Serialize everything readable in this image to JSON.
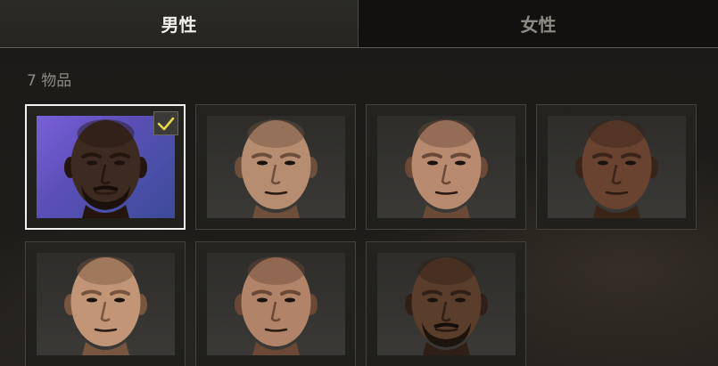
{
  "tabs": [
    {
      "label": "男性",
      "active": true
    },
    {
      "label": "女性",
      "active": false
    }
  ],
  "item_count": "7 物品",
  "selected_index": 0,
  "characters": [
    {
      "skin": "#3d2a20",
      "shade": "#24160f",
      "beard": true,
      "selected": true
    },
    {
      "skin": "#b78d72",
      "shade": "#6e4f3c",
      "beard": false,
      "selected": false
    },
    {
      "skin": "#b88a70",
      "shade": "#6b4937",
      "beard": false,
      "selected": false
    },
    {
      "skin": "#6a4330",
      "shade": "#3a2418",
      "beard": false,
      "selected": false
    },
    {
      "skin": "#c19576",
      "shade": "#78553f",
      "beard": false,
      "selected": false
    },
    {
      "skin": "#b18469",
      "shade": "#6a4835",
      "beard": false,
      "selected": false
    },
    {
      "skin": "#5b3d2c",
      "shade": "#2f1f16",
      "beard": true,
      "selected": false
    }
  ],
  "colors": {
    "selected_border": "#f2f2f2",
    "checkmark": "#e8d44d",
    "selected_background": "#6a58c8"
  },
  "icons": {
    "checkmark": "check-icon"
  }
}
